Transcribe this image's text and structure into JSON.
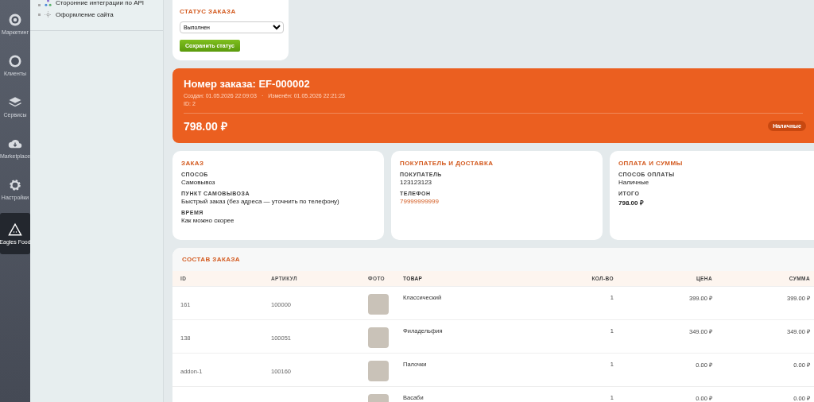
{
  "rail": [
    {
      "label": "Маркетинг",
      "selected": false
    },
    {
      "label": "Клиенты",
      "selected": false
    },
    {
      "label": "Сервисы",
      "selected": false
    },
    {
      "label": "Marketplace",
      "selected": false
    },
    {
      "label": "Настройки",
      "selected": false
    },
    {
      "label": "Eagles Food",
      "selected": true
    }
  ],
  "sidebar": {
    "items": [
      {
        "label": "Сторонние интеграции по API"
      },
      {
        "label": "Оформление сайта"
      }
    ]
  },
  "status_card": {
    "title": "СТАТУС ЗАКАЗА",
    "status": "Выполнен",
    "button": "Сохранить статус"
  },
  "order_banner": {
    "title": "Номер заказа: EF-000002",
    "created": "Создан: 01.05.2026 22:09:03",
    "separator": "·",
    "changed": "Изменён: 01.05.2026 22:21:23",
    "id": "ID: 2",
    "total": "798.00 ₽",
    "payment_badge": "Наличные"
  },
  "info_cards": [
    {
      "title": "ЗАКАЗ",
      "fields": [
        {
          "label": "СПОСОБ",
          "value": "Самовывоз",
          "kind": "text"
        },
        {
          "label": "ПУНКТ САМОВЫВОЗА",
          "value": "Быстрый заказ (без адреса — уточнить по телефону)",
          "kind": "text"
        },
        {
          "label": "ВРЕМЯ",
          "value": "Как можно скорее",
          "kind": "text"
        }
      ]
    },
    {
      "title": "ПОКУПАТЕЛЬ И ДОСТАВКА",
      "fields": [
        {
          "label": "ПОКУПАТЕЛЬ",
          "value": "123123123",
          "kind": "text"
        },
        {
          "label": "ТЕЛЕФОН",
          "value": "79999999999",
          "kind": "link"
        }
      ]
    },
    {
      "title": "ОПЛАТА И СУММЫ",
      "fields": [
        {
          "label": "СПОСОБ ОПЛАТЫ",
          "value": "Наличные",
          "kind": "text"
        },
        {
          "label": "ИТОГО",
          "value": "798.00 ₽",
          "kind": "bold"
        }
      ]
    }
  ],
  "items_table": {
    "title": "СОСТАВ ЗАКАЗА",
    "columns": [
      "ID",
      "АРТИКУЛ",
      "ФОТО",
      "ТОВАР",
      "КОЛ-ВО",
      "ЦЕНА",
      "СУММА"
    ],
    "rows": [
      {
        "id": "161",
        "article": "100000",
        "product": "Классический",
        "qty": "1",
        "price": "399.00 ₽",
        "sum": "399.00 ₽"
      },
      {
        "id": "138",
        "article": "100051",
        "product": "Филадельфия",
        "qty": "1",
        "price": "349.00 ₽",
        "sum": "349.00 ₽"
      },
      {
        "id": "addon-1",
        "article": "100160",
        "product": "Палочки",
        "qty": "1",
        "price": "0.00 ₽",
        "sum": "0.00 ₽"
      },
      {
        "product": "Васаби",
        "qty": "1",
        "price": "0.00 ₽",
        "sum": "0.00 ₽"
      }
    ]
  }
}
